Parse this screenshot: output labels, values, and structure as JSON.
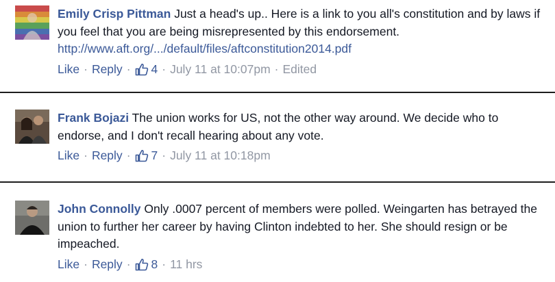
{
  "comments": [
    {
      "author": "Emily Crisp Pittman",
      "text_before_link": " Just a head's up.. Here is a link to you all's constitution and by laws if you feel that you are being misrepresented by this endorsement. ",
      "link": "http://www.aft.org/.../default/files/aftconstitution2014.pdf",
      "like_label": "Like",
      "reply_label": "Reply",
      "like_count": "4",
      "timestamp": "July 11 at 10:07pm",
      "edited": "Edited"
    },
    {
      "author": "Frank Bojazi",
      "text": " The union works for US, not the other way around. We decide who to endorse, and I don't recall hearing about any vote.",
      "like_label": "Like",
      "reply_label": "Reply",
      "like_count": "7",
      "timestamp": "July 11 at 10:18pm"
    },
    {
      "author": "John Connolly",
      "text": " Only .0007 percent of members were polled. Weingarten has betrayed the union to further her career by having Clinton indebted to her. She should resign or be impeached.",
      "like_label": "Like",
      "reply_label": "Reply",
      "like_count": "8",
      "timestamp": "11 hrs"
    }
  ],
  "separator": "·",
  "colors": {
    "link": "#3b5998",
    "meta": "#9197a3",
    "text": "#141823"
  },
  "icons": {
    "like": "thumbs-up-icon"
  }
}
